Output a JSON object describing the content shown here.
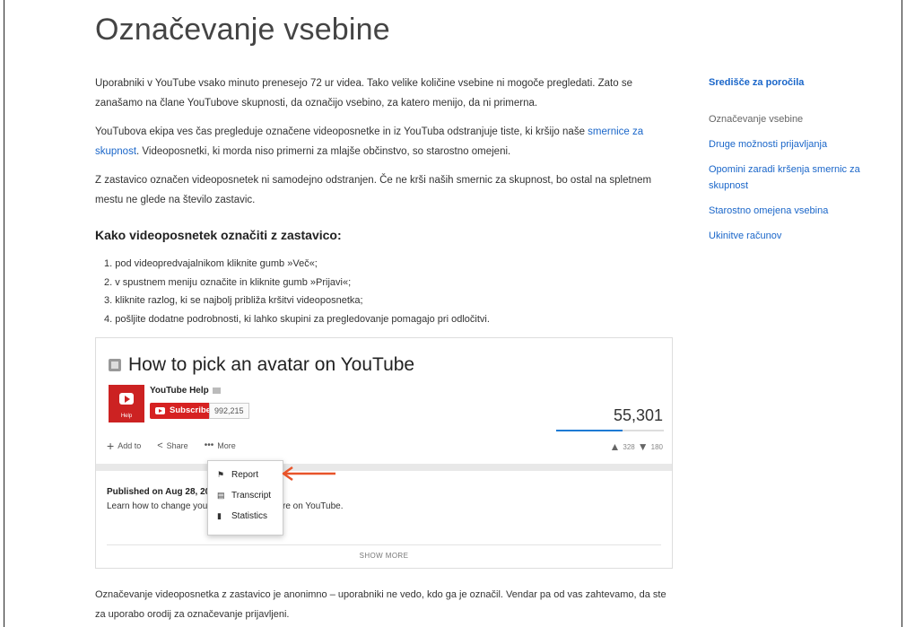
{
  "page": {
    "title": "Označevanje vsebine"
  },
  "intro": {
    "p1": "Uporabniki v YouTube vsako minuto prenesejo 72 ur videa. Tako velike količine vsebine ni mogoče pregledati. Zato se zanašamo na člane YouTubove skupnosti, da označijo vsebino, za katero menijo, da ni primerna.",
    "p2_before": "YouTubova ekipa ves čas pregleduje označene videoposnetke in iz YouTuba odstranjuje tiste, ki kršijo naše ",
    "p2_link": "smernice za skupnost",
    "p2_after": ". Videoposnetki, ki morda niso primerni za mlajše občinstvo, so starostno omejeni.",
    "p3": "Z zastavico označen videoposnetek ni samodejno odstranjen. Če ne krši naših smernic za skupnost, bo ostal na spletnem mestu ne glede na število zastavic."
  },
  "howto": {
    "heading": "Kako videoposnetek označiti z zastavico:",
    "steps": [
      "1. pod videopredvajalnikom kliknite gumb »Več«;",
      "2. v spustnem meniju označite in kliknite gumb »Prijavi«;",
      "3. kliknite razlog, ki se najbolj približa kršitvi videoposnetka;",
      "4. pošljite dodatne podrobnosti, ki lahko skupini za pregledovanje pomagajo pri odločitvi."
    ]
  },
  "screenshot": {
    "video_title": "How to pick an avatar on YouTube",
    "channel_avatar_label": "Help",
    "channel_name": "YouTube Help",
    "subscribe_label": "Subscribe",
    "subscriber_count": "992,215",
    "view_count": "55,301",
    "views_fill_fraction": 0.62,
    "actions": {
      "add_to": "Add to",
      "share": "Share",
      "more": "More"
    },
    "likes": "328",
    "dislikes": "180",
    "menu": {
      "report": "Report",
      "transcript": "Transcript",
      "statistics": "Statistics"
    },
    "published": "Published on Aug 28, 20",
    "description_start": "Learn how to change your",
    "description_end": "re on YouTube.",
    "show_more": "SHOW MORE",
    "arrow_color": "#e8542a"
  },
  "sidebar": {
    "heading": "Središče za poročila",
    "current": "Označevanje vsebine",
    "links": [
      "Druge možnosti prijavljanja",
      "Opomini zaradi kršenja smernic za skupnost",
      "Starostno omejena vsebina",
      "Ukinitve računov"
    ]
  },
  "footer": {
    "text": "Označevanje videoposnetka z zastavico je anonimno – uporabniki ne vedo, kdo ga je označil. Vendar pa od vas zahtevamo, da ste za uporabo orodij za označevanje prijavljeni."
  },
  "colors": {
    "link": "#1a66c9",
    "youtube_red": "#d62222"
  }
}
